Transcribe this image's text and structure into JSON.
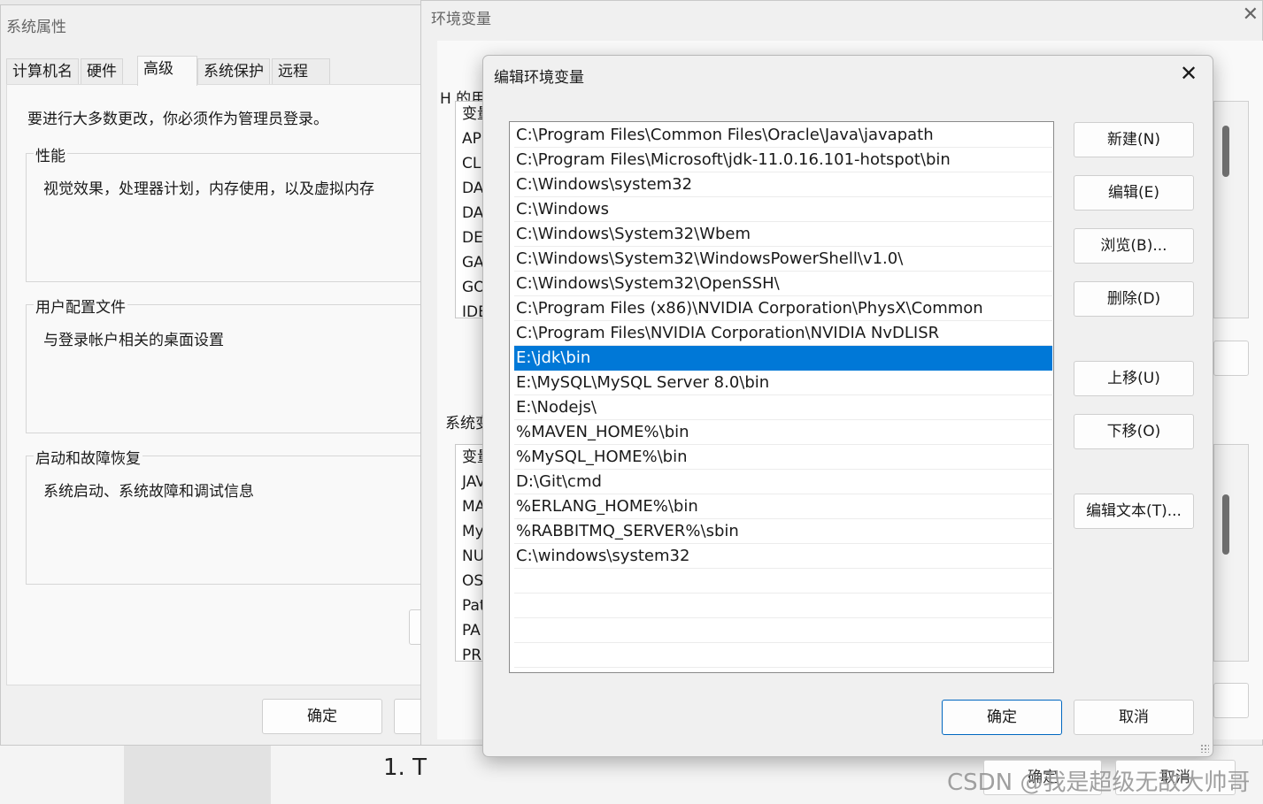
{
  "background": {
    "doc_fragment": "1. T"
  },
  "system_properties": {
    "title": "系统属性",
    "tabs": [
      "计算机名",
      "硬件",
      "高级",
      "系统保护",
      "远程"
    ],
    "active_tab": "高级",
    "admin_note": "要进行大多数更改，你必须作为管理员登录。",
    "performance": {
      "label": "性能",
      "desc": "视觉效果，处理器计划，内存使用，以及虚拟内存"
    },
    "user_profiles": {
      "label": "用户配置文件",
      "desc": "与登录帐户相关的桌面设置"
    },
    "startup_recovery": {
      "label": "启动和故障恢复",
      "desc": "系统启动、系统故障和调试信息"
    },
    "ok_label": "确定"
  },
  "environment_variables": {
    "title": "环境变量",
    "user_group_label": "H 的用",
    "system_group_label": "系统变",
    "user_vars": [
      "变量",
      "AP",
      "CLI",
      "DA",
      "DA",
      "DE",
      "GA",
      "GO",
      "IDE"
    ],
    "system_vars": [
      "变量",
      "JAV",
      "MA",
      "My",
      "NU",
      "OS",
      "Pat",
      "PA",
      "PR"
    ]
  },
  "edit_dialog": {
    "title": "编辑环境变量",
    "paths": [
      "C:\\Program Files\\Common Files\\Oracle\\Java\\javapath",
      "C:\\Program Files\\Microsoft\\jdk-11.0.16.101-hotspot\\bin",
      "C:\\Windows\\system32",
      "C:\\Windows",
      "C:\\Windows\\System32\\Wbem",
      "C:\\Windows\\System32\\WindowsPowerShell\\v1.0\\",
      "C:\\Windows\\System32\\OpenSSH\\",
      "C:\\Program Files (x86)\\NVIDIA Corporation\\PhysX\\Common",
      "C:\\Program Files\\NVIDIA Corporation\\NVIDIA NvDLISR",
      "E:\\jdk\\bin",
      "E:\\MySQL\\MySQL Server 8.0\\bin",
      "E:\\Nodejs\\",
      "%MAVEN_HOME%\\bin",
      "%MySQL_HOME%\\bin",
      "D:\\Git\\cmd",
      "%ERLANG_HOME%\\bin",
      "%RABBITMQ_SERVER%\\sbin",
      "C:\\windows\\system32"
    ],
    "selected_path": "E:\\jdk\\bin",
    "buttons": {
      "new": "新建(N)",
      "edit": "编辑(E)",
      "browse": "浏览(B)...",
      "delete": "删除(D)",
      "move_up": "上移(U)",
      "move_down": "下移(O)",
      "edit_text": "编辑文本(T)..."
    },
    "ok_label": "确定",
    "cancel_label": "取消"
  },
  "underlying_buttons": {
    "ok_label": "确定",
    "cancel_label": "取消"
  },
  "watermark": "CSDN @我是超级无敌大帅哥"
}
